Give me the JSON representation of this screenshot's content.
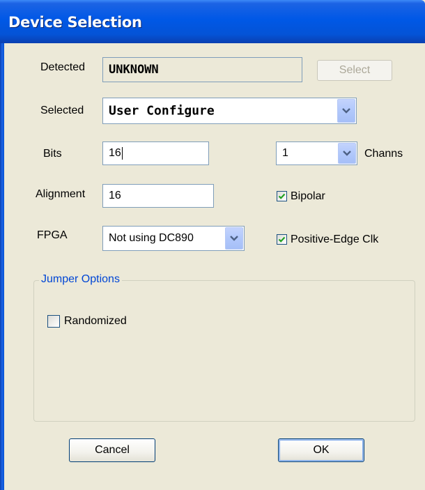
{
  "window": {
    "title": "Device Selection"
  },
  "detected": {
    "label": "Detected",
    "value": "UNKNOWN",
    "select_button": "Select"
  },
  "selected": {
    "label": "Selected",
    "value": "User Configure"
  },
  "bits": {
    "label": "Bits",
    "value": "16"
  },
  "channels": {
    "value": "1",
    "label": "Channs"
  },
  "alignment": {
    "label": "Alignment",
    "value": "16"
  },
  "bipolar": {
    "label": "Bipolar",
    "checked": true
  },
  "fpga": {
    "label": "FPGA",
    "value": "Not using DC890"
  },
  "positive_edge": {
    "label": "Positive-Edge Clk",
    "checked": true
  },
  "jumper_options": {
    "title": "Jumper Options",
    "randomized": {
      "label": "Randomized",
      "checked": false
    }
  },
  "buttons": {
    "cancel": "Cancel",
    "ok": "OK"
  },
  "colors": {
    "title_bar": "#0058e6",
    "dialog_bg": "#ece9d8",
    "group_title": "#0046d5",
    "checkmark": "#21a121"
  }
}
